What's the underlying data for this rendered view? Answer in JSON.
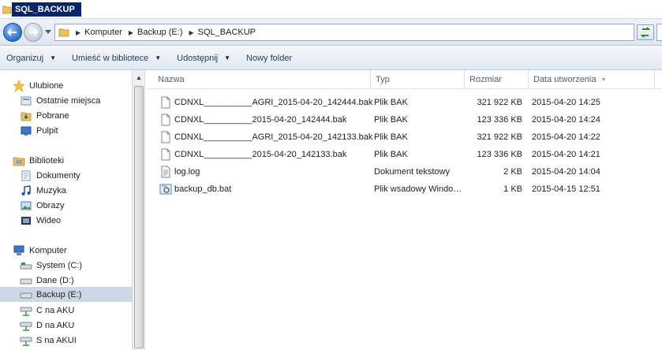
{
  "window": {
    "title": "SQL_BACKUP"
  },
  "address": {
    "crumbs": [
      "Komputer",
      "Backup (E:)",
      "SQL_BACKUP"
    ]
  },
  "toolbar": {
    "organize": "Organizuj",
    "library": "Umieść w bibliotece",
    "share": "Udostępnij",
    "new_folder": "Nowy folder"
  },
  "nav": {
    "favorites": "Ulubione",
    "recent": "Ostatnie miejsca",
    "downloads": "Pobrane",
    "desktop": "Pulpit",
    "libraries": "Biblioteki",
    "documents": "Dokumenty",
    "music": "Muzyka",
    "pictures": "Obrazy",
    "videos": "Wideo",
    "computer": "Komputer",
    "drive_c": "System (C:)",
    "drive_d": "Dane (D:)",
    "drive_e": "Backup (E:)",
    "net_c": "C na AKU",
    "net_d": "D na AKU",
    "net_s": "S na AKUI"
  },
  "columns": {
    "name": "Nazwa",
    "type": "Typ",
    "size": "Rozmiar",
    "date": "Data utworzenia"
  },
  "files": [
    {
      "name": "CDNXL__________AGRI_2015-04-20_142444.bak",
      "type": "Plik BAK",
      "size": "321 922 KB",
      "date": "2015-04-20 14:25",
      "icon": "file-icon"
    },
    {
      "name": "CDNXL__________2015-04-20_142444.bak",
      "type": "Plik BAK",
      "size": "123 336 KB",
      "date": "2015-04-20 14:24",
      "icon": "file-icon"
    },
    {
      "name": "CDNXL__________AGRI_2015-04-20_142133.bak",
      "type": "Plik BAK",
      "size": "321 922 KB",
      "date": "2015-04-20 14:22",
      "icon": "file-icon"
    },
    {
      "name": "CDNXL__________2015-04-20_142133.bak",
      "type": "Plik BAK",
      "size": "123 336 KB",
      "date": "2015-04-20 14:21",
      "icon": "file-icon"
    },
    {
      "name": "log.log",
      "type": "Dokument tekstowy",
      "size": "2 KB",
      "date": "2015-04-20 14:04",
      "icon": "text-file-icon"
    },
    {
      "name": "backup_db.bat",
      "type": "Plik wsadowy Windo…",
      "size": "1 KB",
      "date": "2015-04-15 12:51",
      "icon": "batch-file-icon"
    }
  ]
}
